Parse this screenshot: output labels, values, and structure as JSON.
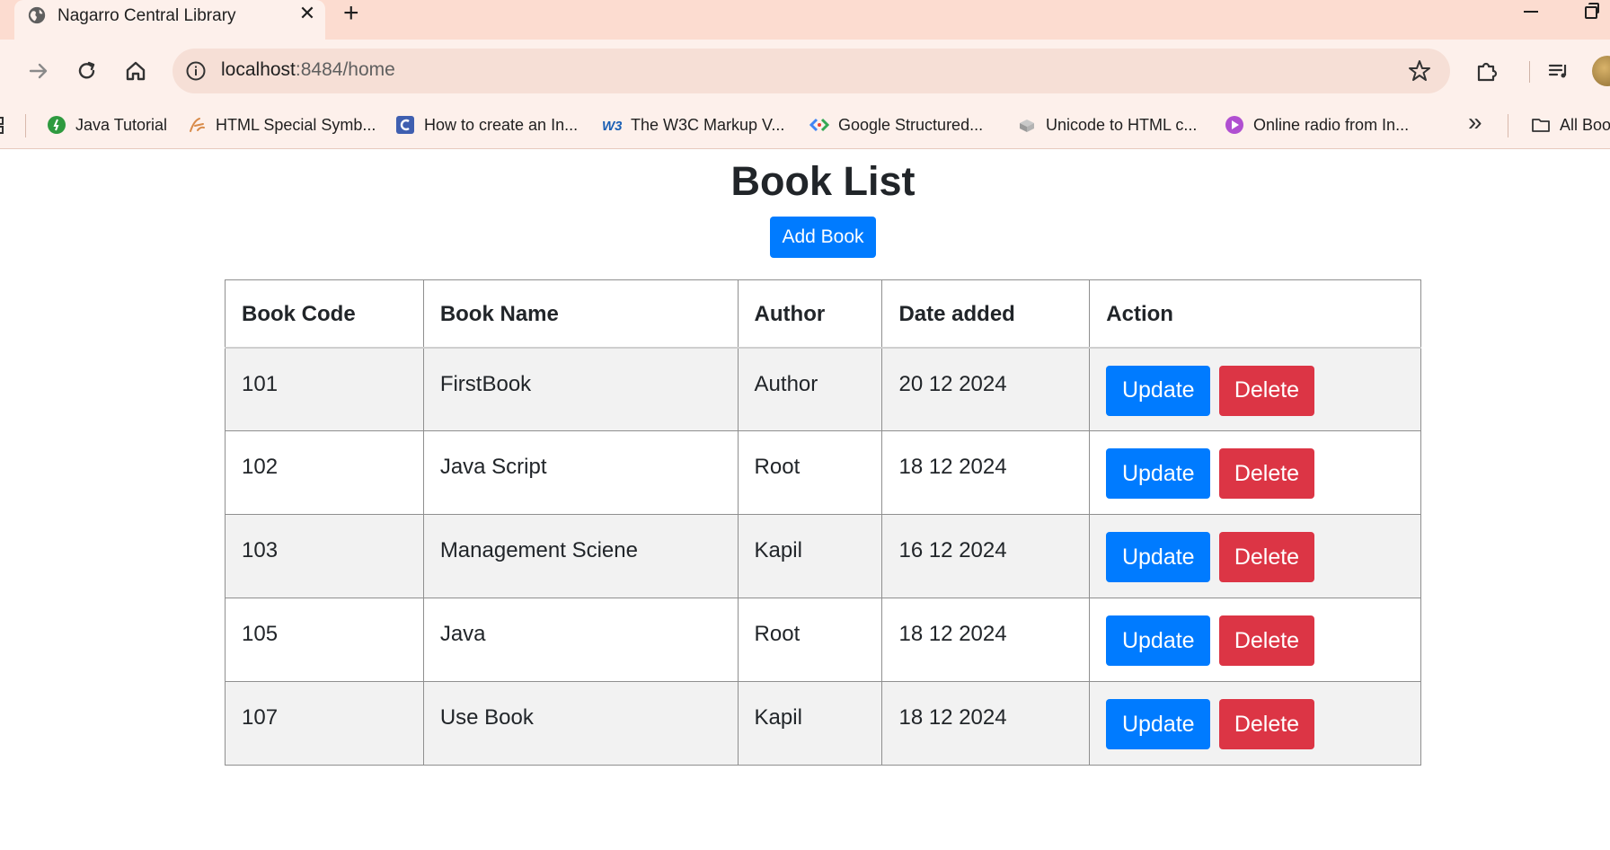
{
  "browser": {
    "tab": {
      "title": "Nagarro Central Library",
      "close": "✕"
    },
    "new_tab": "+",
    "address": {
      "host": "localhost",
      "rest": ":8484/home"
    },
    "bookmarks": [
      {
        "label": "Java Tutorial",
        "icon": "java-tutorial-icon",
        "color": "#2e9a3f"
      },
      {
        "label": "HTML Special Symb...",
        "icon": "html-symbols-icon",
        "color": "#d98b4a"
      },
      {
        "label": "How to create an In...",
        "icon": "how-to-icon",
        "color": "#3f5fb0"
      },
      {
        "label": "The W3C Markup V...",
        "icon": "w3c-icon",
        "color": "#1a5fb4"
      },
      {
        "label": "Google Structured...",
        "icon": "google-structured-icon",
        "color": "#4285f4"
      },
      {
        "label": "Unicode to HTML c...",
        "icon": "unicode-icon",
        "color": "#8a8a8a"
      },
      {
        "label": "Online radio from In...",
        "icon": "radio-icon",
        "color": "#b04fd1"
      }
    ],
    "more_bookmarks": "»",
    "all_bookmarks": "All Boo"
  },
  "page": {
    "title": "Book List",
    "add_button": "Add Book",
    "table": {
      "headers": [
        "Book Code",
        "Book Name",
        "Author",
        "Date added",
        "Action"
      ],
      "rows": [
        {
          "code": "101",
          "name": "FirstBook",
          "author": "Author",
          "date": "20 12 2024"
        },
        {
          "code": "102",
          "name": "Java Script",
          "author": "Root",
          "date": "18 12 2024"
        },
        {
          "code": "103",
          "name": "Management Sciene",
          "author": "Kapil",
          "date": "16 12 2024"
        },
        {
          "code": "105",
          "name": "Java",
          "author": "Root",
          "date": "18 12 2024"
        },
        {
          "code": "107",
          "name": "Use Book",
          "author": "Kapil",
          "date": "18 12 2024"
        }
      ],
      "update_label": "Update",
      "delete_label": "Delete"
    }
  },
  "colors": {
    "primary": "#007bff",
    "danger": "#dc3545",
    "stripe": "#f2f2f2",
    "chrome": "#fcdcd0"
  }
}
